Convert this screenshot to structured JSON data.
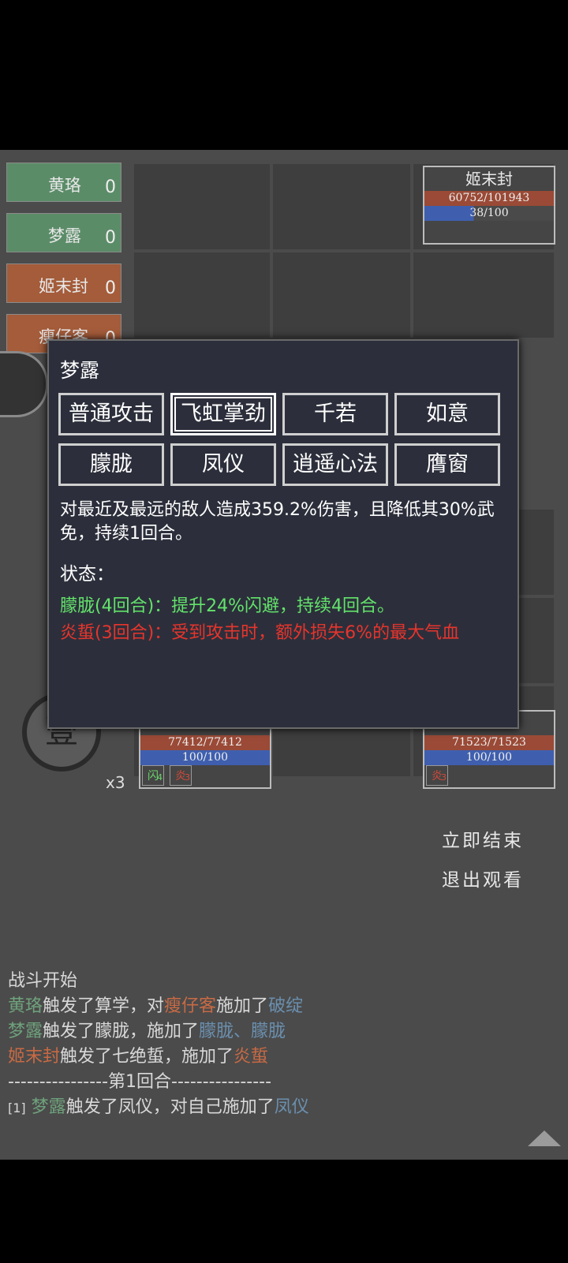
{
  "turn_order": [
    {
      "name": "黄珞",
      "count": "0",
      "side": "ally"
    },
    {
      "name": "梦露",
      "count": "0",
      "side": "ally"
    },
    {
      "name": "姬末封",
      "count": "0",
      "side": "enemy"
    },
    {
      "name": "瘦仔客",
      "count": "0",
      "side": "enemy"
    }
  ],
  "units": {
    "top_right": {
      "name": "姬末封",
      "hp": "60752/101943",
      "mp": "38/100"
    },
    "bottom_left": {
      "hp": "77412/77412",
      "mp": "100/100",
      "badges": [
        {
          "label": "闪",
          "n": "4",
          "type": "dodge"
        },
        {
          "label": "炎",
          "n": "3",
          "type": "burn"
        }
      ]
    },
    "bottom_right": {
      "hp": "71523/71523",
      "mp": "100/100",
      "badges": [
        {
          "label": "炎",
          "n": "3",
          "type": "burn"
        }
      ]
    }
  },
  "seal_char": "壹",
  "multiplier": "x3",
  "actions": {
    "end_now": "立即结束",
    "exit_watch": "退出观看"
  },
  "log": {
    "start": "战斗开始",
    "line1": {
      "a": "黄珞",
      "b": "触发了算学，对",
      "c": "瘦仔客",
      "d": "施加了",
      "e": "破绽"
    },
    "line2": {
      "a": "梦露",
      "b": "触发了朦胧，施加了",
      "c": "朦胧、朦胧"
    },
    "line3": {
      "a": "姬末封",
      "b": "触发了七绝蜇，施加了",
      "c": "炎蜇"
    },
    "round": "----------------第1回合----------------",
    "line4": {
      "idx": "[1]",
      "a": "梦露",
      "b": "触发了凤仪，对自己施加了",
      "c": "凤仪"
    }
  },
  "popup": {
    "name": "梦露",
    "skills": [
      "普通攻击",
      "飞虹掌劲",
      "千若",
      "如意",
      "朦胧",
      "凤仪",
      "逍遥心法",
      "膺窗"
    ],
    "selected_index": 1,
    "description": "对最近及最远的敌人造成359.2%伤害，且降低其30%武免，持续1回合。",
    "status_header": "状态：",
    "status_green": "朦胧(4回合)：提升24%闪避，持续4回合。",
    "status_red": "炎蜇(3回合)：受到攻击时，额外损失6%的最大气血"
  }
}
